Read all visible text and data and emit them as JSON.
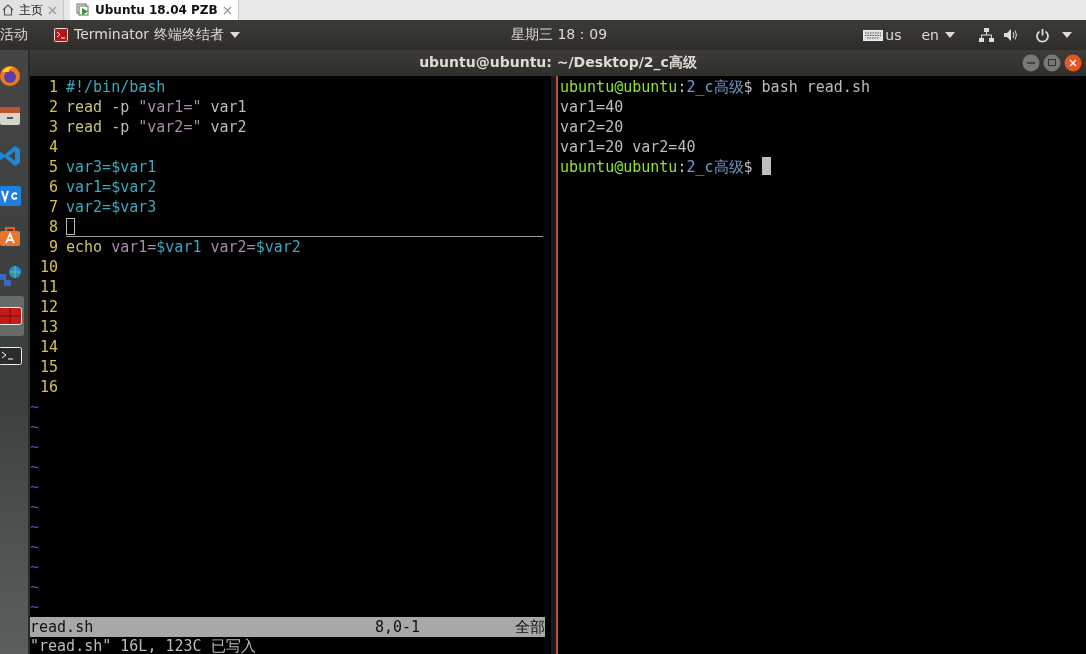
{
  "browser_tabs": [
    {
      "label": "主页",
      "selected": false
    },
    {
      "label": "Ubuntu 18.04 PZB",
      "selected": true
    }
  ],
  "top_panel": {
    "activities": "活动",
    "app_name": "Terminator 终端终结者",
    "clock": "星期三 18：09",
    "keyboard_layout": "us",
    "language": "en"
  },
  "dock": {
    "items": [
      {
        "kind": "firefox",
        "selected": false
      },
      {
        "kind": "files",
        "selected": false
      },
      {
        "kind": "code",
        "selected": false
      },
      {
        "kind": "vnc",
        "selected": false
      },
      {
        "kind": "software",
        "selected": false
      },
      {
        "kind": "network",
        "selected": false
      },
      {
        "kind": "terminator",
        "selected": true
      },
      {
        "kind": "terminal",
        "selected": false
      }
    ]
  },
  "window": {
    "title": "ubuntu@ubuntu: ~/Desktop/2_c高级"
  },
  "editor": {
    "lines": [
      {
        "number": "1",
        "cursor": false,
        "segments": [
          {
            "text": "#!/bin/bash",
            "kind": "comment"
          }
        ]
      },
      {
        "number": "2",
        "cursor": false,
        "segments": [
          {
            "text": "read",
            "kind": "keyword"
          },
          {
            "text": " -p ",
            "kind": "plain"
          },
          {
            "text": "\"var1=\"",
            "kind": "string"
          },
          {
            "text": " var1",
            "kind": "plain"
          }
        ]
      },
      {
        "number": "3",
        "cursor": false,
        "segments": [
          {
            "text": "read",
            "kind": "keyword"
          },
          {
            "text": " -p ",
            "kind": "plain"
          },
          {
            "text": "\"var2=\"",
            "kind": "string"
          },
          {
            "text": " var2",
            "kind": "plain"
          }
        ]
      },
      {
        "number": "4",
        "cursor": false
      },
      {
        "number": "5",
        "cursor": false,
        "segments": [
          {
            "text": "var3=$var1",
            "kind": "variable"
          }
        ]
      },
      {
        "number": "6",
        "cursor": false,
        "segments": [
          {
            "text": "var1=$var2",
            "kind": "variable"
          }
        ]
      },
      {
        "number": "7",
        "cursor": false,
        "segments": [
          {
            "text": "var2=$var3",
            "kind": "variable"
          }
        ]
      },
      {
        "number": "8",
        "cursor": true
      },
      {
        "number": "9",
        "cursor": false,
        "segments": [
          {
            "text": "echo",
            "kind": "keyword"
          },
          {
            "text": " var1=",
            "kind": "string"
          },
          {
            "text": "$var1",
            "kind": "variable"
          },
          {
            "text": " var2=",
            "kind": "string"
          },
          {
            "text": "$var2",
            "kind": "variable"
          }
        ]
      },
      {
        "number": "10",
        "cursor": false
      },
      {
        "number": "11",
        "cursor": false
      },
      {
        "number": "12",
        "cursor": false
      },
      {
        "number": "13",
        "cursor": false
      },
      {
        "number": "14",
        "cursor": false
      },
      {
        "number": "15",
        "cursor": false
      },
      {
        "number": "16",
        "cursor": false
      }
    ],
    "filler": [
      "~",
      "~",
      "~",
      "~",
      "~",
      "~",
      "~",
      "~",
      "~",
      "~",
      "~"
    ],
    "status_line": {
      "file": "read.sh",
      "position": "8,0-1",
      "scroll": "全部"
    },
    "message": "\"read.sh\" 16L, 123C 已写入"
  },
  "terminal": {
    "lines": [
      {
        "cursor": false,
        "segments": [
          {
            "text": "ubuntu@ubuntu",
            "kind": "user"
          },
          {
            "text": ":",
            "kind": "plain"
          },
          {
            "text": "2_c高级",
            "kind": "path"
          },
          {
            "text": "$ bash read.sh",
            "kind": "plain"
          }
        ]
      },
      {
        "cursor": false,
        "segments": [
          {
            "text": "var1=40",
            "kind": "plain"
          }
        ]
      },
      {
        "cursor": false,
        "segments": [
          {
            "text": "var2=20",
            "kind": "plain"
          }
        ]
      },
      {
        "cursor": false,
        "segments": [
          {
            "text": "var1=20 var2=40",
            "kind": "plain"
          }
        ]
      },
      {
        "cursor": true,
        "segments": [
          {
            "text": "ubuntu@ubuntu",
            "kind": "user"
          },
          {
            "text": ":",
            "kind": "plain"
          },
          {
            "text": "2_c高级",
            "kind": "path"
          },
          {
            "text": "$ ",
            "kind": "plain"
          }
        ]
      }
    ]
  }
}
